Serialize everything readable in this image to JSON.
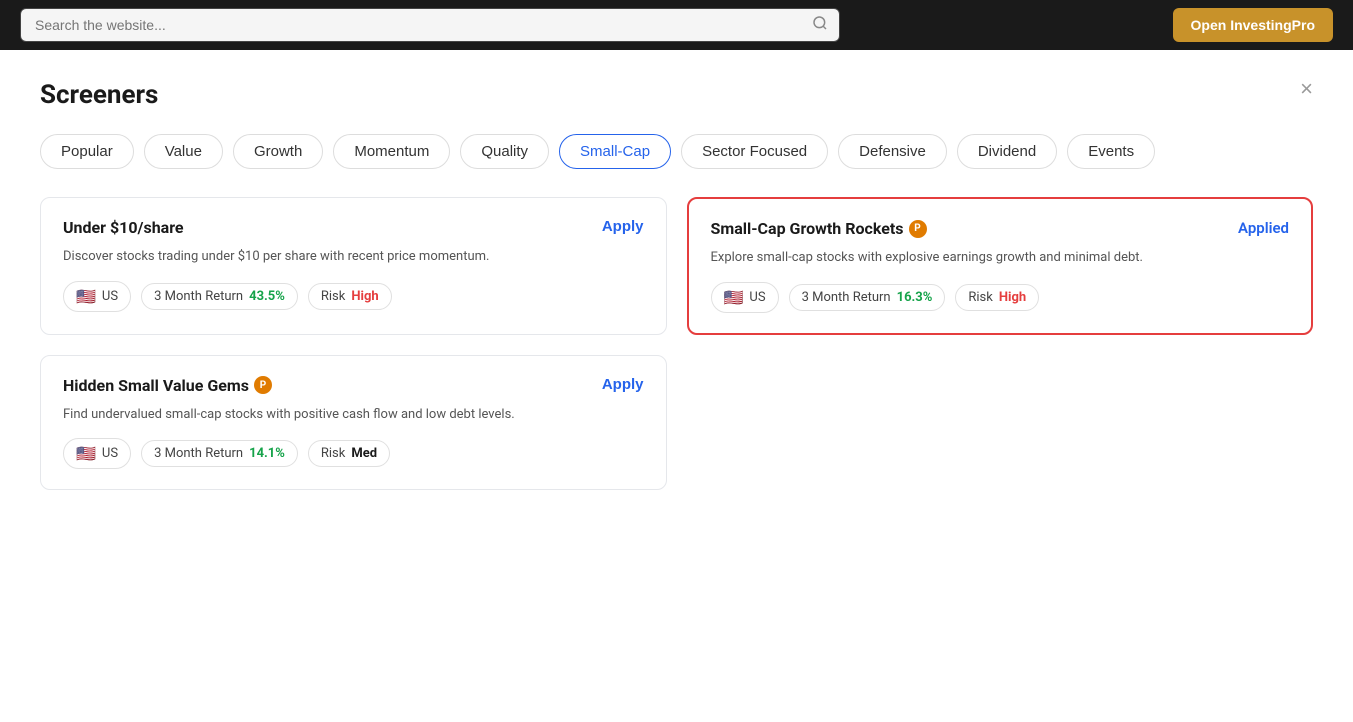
{
  "topbar": {
    "search_placeholder": "Search the website...",
    "open_pro_label": "Open InvestingPro"
  },
  "modal": {
    "title": "Screeners",
    "close_label": "×"
  },
  "filter_tabs": [
    {
      "id": "popular",
      "label": "Popular",
      "active": false
    },
    {
      "id": "value",
      "label": "Value",
      "active": false
    },
    {
      "id": "growth",
      "label": "Growth",
      "active": false
    },
    {
      "id": "momentum",
      "label": "Momentum",
      "active": false
    },
    {
      "id": "quality",
      "label": "Quality",
      "active": false
    },
    {
      "id": "smallcap",
      "label": "Small-Cap",
      "active": true
    },
    {
      "id": "sector",
      "label": "Sector Focused",
      "active": false
    },
    {
      "id": "defensive",
      "label": "Defensive",
      "active": false
    },
    {
      "id": "dividend",
      "label": "Dividend",
      "active": false
    },
    {
      "id": "events",
      "label": "Events",
      "active": false
    }
  ],
  "screeners": [
    {
      "id": "under10",
      "title": "Under $10/share",
      "has_pro": false,
      "action_label": "Apply",
      "applied": false,
      "description": "Discover stocks trading under $10 per share with recent price momentum.",
      "region": "US",
      "region_flag": "🇺🇸",
      "return_label": "3 Month Return",
      "return_value": "43.5%",
      "risk_label": "Risk",
      "risk_value": "High",
      "risk_type": "high"
    },
    {
      "id": "smallcap-growth",
      "title": "Small-Cap Growth Rockets",
      "has_pro": true,
      "action_label": "Applied",
      "applied": true,
      "description": "Explore small-cap stocks with explosive earnings growth and minimal debt.",
      "region": "US",
      "region_flag": "🇺🇸",
      "return_label": "3 Month Return",
      "return_value": "16.3%",
      "risk_label": "Risk",
      "risk_value": "High",
      "risk_type": "high"
    },
    {
      "id": "hidden-gems",
      "title": "Hidden Small Value Gems",
      "has_pro": true,
      "action_label": "Apply",
      "applied": false,
      "description": "Find undervalued small-cap stocks with positive cash flow and low debt levels.",
      "region": "US",
      "region_flag": "🇺🇸",
      "return_label": "3 Month Return",
      "return_value": "14.1%",
      "risk_label": "Risk",
      "risk_value": "Med",
      "risk_type": "med"
    }
  ]
}
